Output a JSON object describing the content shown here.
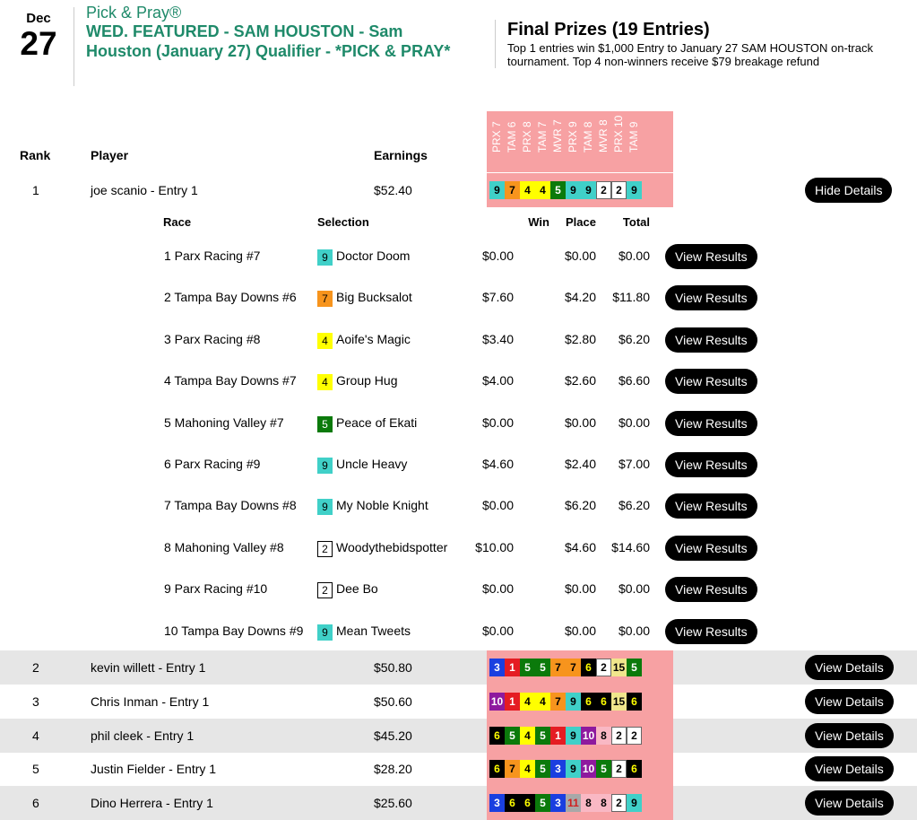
{
  "header": {
    "month": "Dec",
    "day": "27",
    "brand": "Pick & Pray®",
    "title": "WED. FEATURED - SAM HOUSTON - Sam Houston (January 27) Qualifier - *PICK & PRAY*",
    "prizes_title": "Final Prizes (19 Entries)",
    "prizes_text": "Top 1 entries win $1,000 Entry to January 27 SAM HOUSTON on-track tournament. Top 4 non-winners receive $79 breakage refund"
  },
  "columns": {
    "rank": "Rank",
    "player": "Player",
    "earnings": "Earnings"
  },
  "races": [
    "PRX 7",
    "TAM 6",
    "PRX 8",
    "TAM 7",
    "MVR 7",
    "PRX 9",
    "TAM 8",
    "MVR 8",
    "PRX 10",
    "TAM 9"
  ],
  "detail_columns": {
    "race": "Race",
    "selection": "Selection",
    "win": "Win",
    "place": "Place",
    "total": "Total"
  },
  "buttons": {
    "hide": "Hide Details",
    "view_details": "View Details",
    "view_results": "View Results"
  },
  "colors": {
    "1": {
      "bg": "#e51c23",
      "fg": "#ffffff"
    },
    "2": {
      "bg": "#ffffff",
      "fg": "#000000"
    },
    "3": {
      "bg": "#1a3fe0",
      "fg": "#ffffff"
    },
    "4": {
      "bg": "#ffff00",
      "fg": "#000000"
    },
    "5": {
      "bg": "#0b7a0b",
      "fg": "#ffffff"
    },
    "6": {
      "bg": "#000000",
      "fg": "#ffff00"
    },
    "7": {
      "bg": "#f7941d",
      "fg": "#000000"
    },
    "8": {
      "bg": "#f9b8c4",
      "fg": "#000000"
    },
    "9": {
      "bg": "#40d0c8",
      "fg": "#000000"
    },
    "10": {
      "bg": "#8e1a9e",
      "fg": "#ffffff"
    },
    "11": {
      "bg": "#a8a8a8",
      "fg": "#d12020"
    },
    "15": {
      "bg": "#f0e68c",
      "fg": "#000000"
    }
  },
  "players": [
    {
      "rank": "1",
      "name": "joe scanio - Entry 1",
      "earnings": "$52.40",
      "picks": [
        "9",
        "7",
        "4",
        "4",
        "5",
        "9",
        "9",
        "2",
        "2",
        "9"
      ],
      "expanded": true
    },
    {
      "rank": "2",
      "name": "kevin willett - Entry 1",
      "earnings": "$50.80",
      "picks": [
        "3",
        "1",
        "5",
        "5",
        "7",
        "7",
        "6",
        "2",
        "15",
        "5"
      ]
    },
    {
      "rank": "3",
      "name": "Chris Inman - Entry 1",
      "earnings": "$50.60",
      "picks": [
        "10",
        "1",
        "4",
        "4",
        "7",
        "9",
        "6",
        "6",
        "15",
        "6"
      ]
    },
    {
      "rank": "4",
      "name": "phil cleek - Entry 1",
      "earnings": "$45.20",
      "picks": [
        "6",
        "5",
        "4",
        "5",
        "1",
        "9",
        "10",
        "8",
        "2",
        "2"
      ]
    },
    {
      "rank": "5",
      "name": "Justin Fielder - Entry 1",
      "earnings": "$28.20",
      "picks": [
        "6",
        "7",
        "4",
        "5",
        "3",
        "9",
        "10",
        "5",
        "2",
        "6"
      ]
    },
    {
      "rank": "6",
      "name": "Dino Herrera - Entry 1",
      "earnings": "$25.60",
      "picks": [
        "3",
        "6",
        "6",
        "5",
        "3",
        "11",
        "8",
        "8",
        "2",
        "9"
      ]
    }
  ],
  "details": [
    {
      "race": "1 Parx Racing #7",
      "num": "9",
      "horse": "Doctor Doom",
      "win": "$0.00",
      "place": "$0.00",
      "total": "$0.00"
    },
    {
      "race": "2 Tampa Bay Downs #6",
      "num": "7",
      "horse": "Big Bucksalot",
      "win": "$7.60",
      "place": "$4.20",
      "total": "$11.80"
    },
    {
      "race": "3 Parx Racing #8",
      "num": "4",
      "horse": "Aoife's Magic",
      "win": "$3.40",
      "place": "$2.80",
      "total": "$6.20"
    },
    {
      "race": "4 Tampa Bay Downs #7",
      "num": "4",
      "horse": "Group Hug",
      "win": "$4.00",
      "place": "$2.60",
      "total": "$6.60"
    },
    {
      "race": "5 Mahoning Valley #7",
      "num": "5",
      "horse": "Peace of Ekati",
      "win": "$0.00",
      "place": "$0.00",
      "total": "$0.00"
    },
    {
      "race": "6 Parx Racing #9",
      "num": "9",
      "horse": "Uncle Heavy",
      "win": "$4.60",
      "place": "$2.40",
      "total": "$7.00"
    },
    {
      "race": "7 Tampa Bay Downs #8",
      "num": "9",
      "horse": "My Noble Knight",
      "win": "$0.00",
      "place": "$6.20",
      "total": "$6.20"
    },
    {
      "race": "8 Mahoning Valley #8",
      "num": "2",
      "horse": "Woodythebidspotter",
      "win": "$10.00",
      "place": "$4.60",
      "total": "$14.60"
    },
    {
      "race": "9 Parx Racing #10",
      "num": "2",
      "horse": "Dee Bo",
      "win": "$0.00",
      "place": "$0.00",
      "total": "$0.00"
    },
    {
      "race": "10 Tampa Bay Downs #9",
      "num": "9",
      "horse": "Mean Tweets",
      "win": "$0.00",
      "place": "$0.00",
      "total": "$0.00"
    }
  ]
}
